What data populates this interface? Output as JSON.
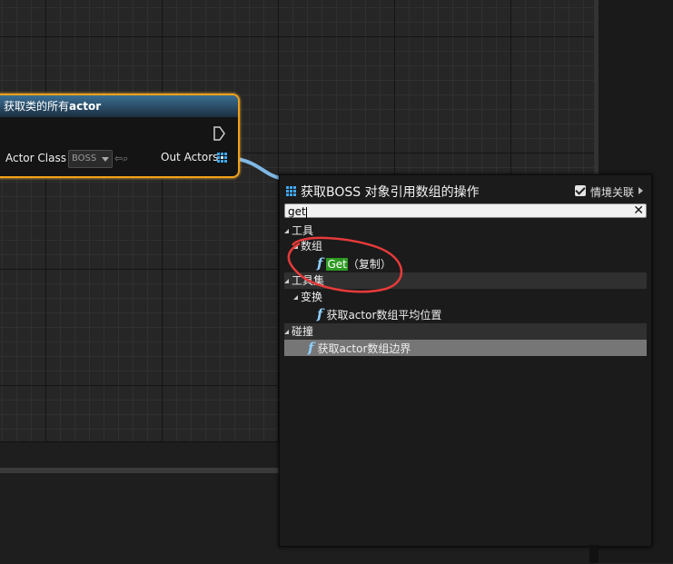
{
  "node": {
    "title_prefix": "获取类的所有",
    "title_bold": "actor",
    "input_label": "Actor Class",
    "class_value": "BOSS",
    "output_label": "Out Actors"
  },
  "menu": {
    "title": "获取BOSS 对象引用数组的操作",
    "context_label": "情境关联",
    "search_value": "get",
    "rows": [
      {
        "label": "工具"
      },
      {
        "label": "数组"
      },
      {
        "label_highlight": "Get",
        "label_rest": "（复制）"
      },
      {
        "label": "工具集"
      },
      {
        "label": "变换"
      },
      {
        "label": "获取actor数组平均位置"
      },
      {
        "label": "碰撞"
      },
      {
        "label": "获取actor数组边界"
      }
    ]
  },
  "colors": {
    "node_border": "#f0a019",
    "header_blue": "#3b6f93",
    "wire": "#7fb8e6",
    "annotation": "#e83a3a",
    "highlight": "#2e9b24"
  }
}
